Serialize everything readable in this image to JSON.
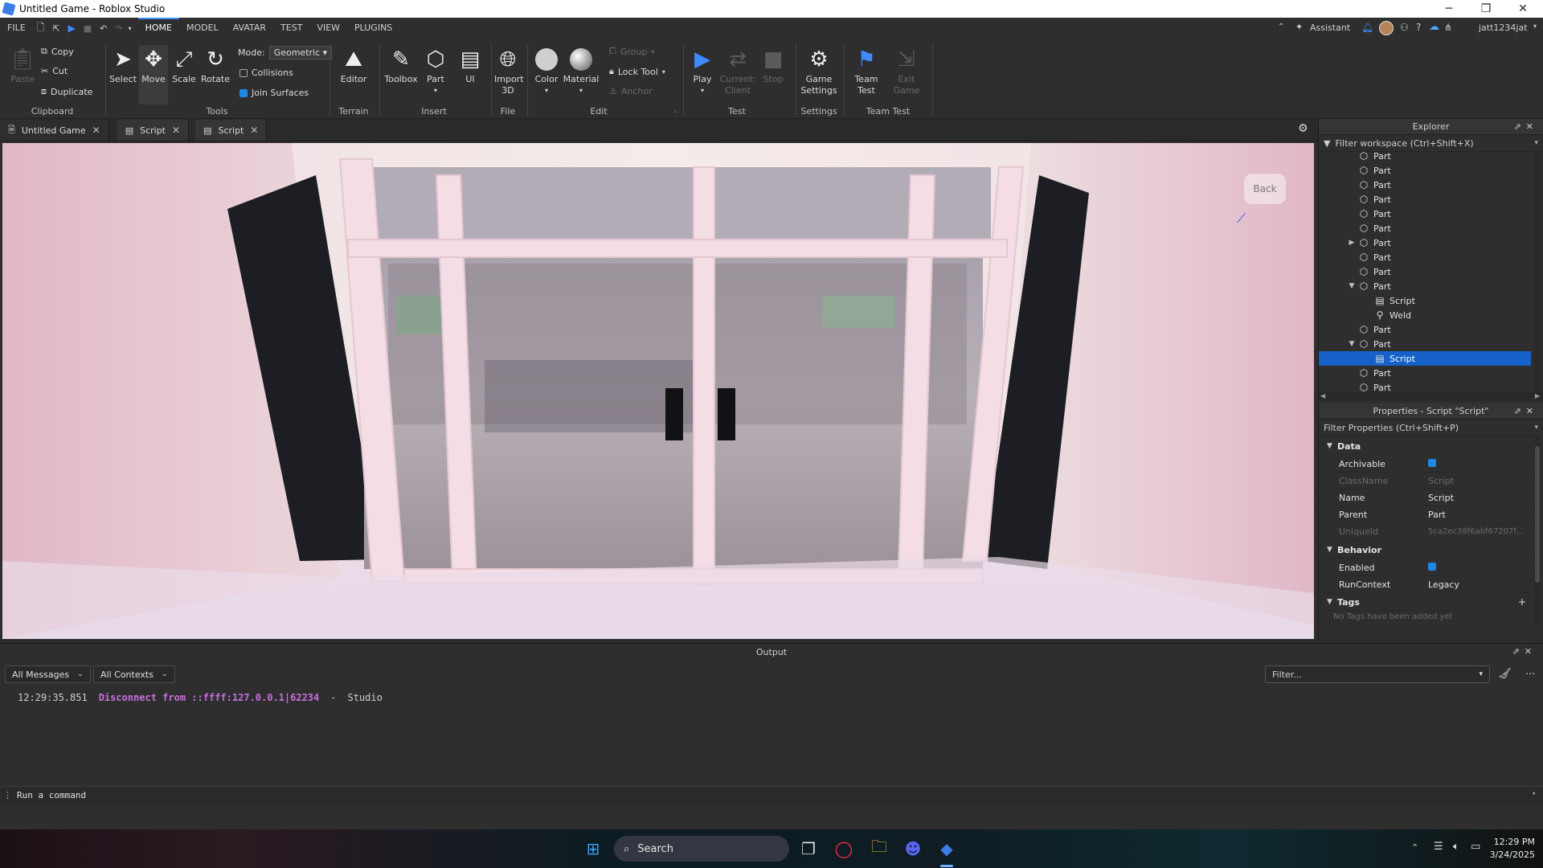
{
  "window": {
    "title": "Untitled Game - Roblox Studio",
    "minimize": "─",
    "maximize": "❐",
    "close": "✕"
  },
  "menubar": {
    "file": "FILE",
    "tabs": [
      "HOME",
      "MODEL",
      "AVATAR",
      "TEST",
      "VIEW",
      "PLUGINS"
    ],
    "active_tab": "HOME",
    "assistant": "Assistant",
    "username": "jatt1234jat"
  },
  "ribbon": {
    "clipboard": {
      "paste": "Paste",
      "copy": "Copy",
      "cut": "Cut",
      "duplicate": "Duplicate",
      "group_label": "Clipboard"
    },
    "tools": {
      "select": "Select",
      "move": "Move",
      "scale": "Scale",
      "rotate": "Rotate",
      "mode_label": "Mode:",
      "mode_value": "Geometric",
      "collisions": "Collisions",
      "collisions_checked": false,
      "join_surfaces": "Join Surfaces",
      "join_surfaces_checked": true,
      "group_label": "Tools"
    },
    "terrain": {
      "editor": "Editor",
      "group_label": "Terrain"
    },
    "insert": {
      "toolbox": "Toolbox",
      "part": "Part",
      "ui": "UI",
      "group_label": "Insert"
    },
    "file": {
      "import_3d": "Import 3D",
      "group_label": "File"
    },
    "edit": {
      "color": "Color",
      "material": "Material",
      "group": "Group",
      "lock_tool": "Lock Tool",
      "anchor": "Anchor",
      "group_label": "Edit"
    },
    "test": {
      "play": "Play",
      "current_client": "Current: Client",
      "stop": "Stop",
      "group_label": "Test"
    },
    "settings": {
      "game_settings": "Game Settings",
      "group_label": "Settings"
    },
    "team_test": {
      "team_test": "Team Test",
      "exit_game": "Exit Game",
      "group_label": "Team Test"
    }
  },
  "doc_tabs": [
    {
      "label": "Untitled Game",
      "active": true
    },
    {
      "label": "Script",
      "active": false
    },
    {
      "label": "Script",
      "active": false
    }
  ],
  "viewport": {
    "back_label": "Back"
  },
  "explorer": {
    "title": "Explorer",
    "filter": "Filter workspace (Ctrl+Shift+X)",
    "rows": [
      {
        "label": "Part",
        "icon": "part-icon",
        "depth": 0,
        "toggle": ""
      },
      {
        "label": "Part",
        "icon": "part-icon",
        "depth": 0,
        "toggle": ""
      },
      {
        "label": "Part",
        "icon": "part-icon",
        "depth": 0,
        "toggle": ""
      },
      {
        "label": "Part",
        "icon": "part-icon",
        "depth": 0,
        "toggle": ""
      },
      {
        "label": "Part",
        "icon": "part-icon",
        "depth": 0,
        "toggle": ""
      },
      {
        "label": "Part",
        "icon": "part-icon",
        "depth": 0,
        "toggle": ""
      },
      {
        "label": "Part",
        "icon": "part-icon",
        "depth": 0,
        "toggle": "collapsed"
      },
      {
        "label": "Part",
        "icon": "part-icon",
        "depth": 0,
        "toggle": ""
      },
      {
        "label": "Part",
        "icon": "part-icon",
        "depth": 0,
        "toggle": ""
      },
      {
        "label": "Part",
        "icon": "part-icon",
        "depth": 0,
        "toggle": "expanded"
      },
      {
        "label": "Script",
        "icon": "script-icon",
        "depth": 1,
        "toggle": ""
      },
      {
        "label": "Weld",
        "icon": "weld-icon",
        "depth": 1,
        "toggle": ""
      },
      {
        "label": "Part",
        "icon": "part-icon",
        "depth": 0,
        "toggle": ""
      },
      {
        "label": "Part",
        "icon": "part-icon",
        "depth": 0,
        "toggle": "expanded"
      },
      {
        "label": "Script",
        "icon": "script-icon",
        "depth": 1,
        "toggle": "",
        "selected": true
      },
      {
        "label": "Part",
        "icon": "part-icon",
        "depth": 0,
        "toggle": ""
      },
      {
        "label": "Part",
        "icon": "part-icon",
        "depth": 0,
        "toggle": ""
      }
    ]
  },
  "properties": {
    "title": "Properties - Script \"Script\"",
    "filter": "Filter Properties (Ctrl+Shift+P)",
    "sections": {
      "data": "Data",
      "behavior": "Behavior",
      "tags": "Tags"
    },
    "archivable": {
      "name": "Archivable",
      "checked": true
    },
    "classname": {
      "name": "ClassName",
      "value": "Script"
    },
    "name": {
      "name": "Name",
      "value": "Script"
    },
    "parent": {
      "name": "Parent",
      "value": "Part"
    },
    "uniqueid": {
      "name": "UniqueId",
      "value": "5ca2ec38f6abf67207f..."
    },
    "enabled": {
      "name": "Enabled",
      "checked": true
    },
    "runcontext": {
      "name": "RunContext",
      "value": "Legacy"
    },
    "no_tags": "No Tags have been added yet"
  },
  "output": {
    "title": "Output",
    "messages_filter": "All Messages",
    "contexts_filter": "All Contexts",
    "filter_placeholder": "Filter...",
    "log": [
      {
        "time": "12:29:35.851",
        "message": "Disconnect from ::ffff:127.0.0.1|62234",
        "separator": "-",
        "source": "Studio"
      }
    ]
  },
  "command_bar": {
    "placeholder": "Run a command"
  },
  "taskbar": {
    "search": "Search",
    "time": "12:29 PM",
    "date": "3/24/2025"
  },
  "colors": {
    "accent": "#1660c9",
    "play": "#3e8bff",
    "log_message": "#c86fe0"
  }
}
